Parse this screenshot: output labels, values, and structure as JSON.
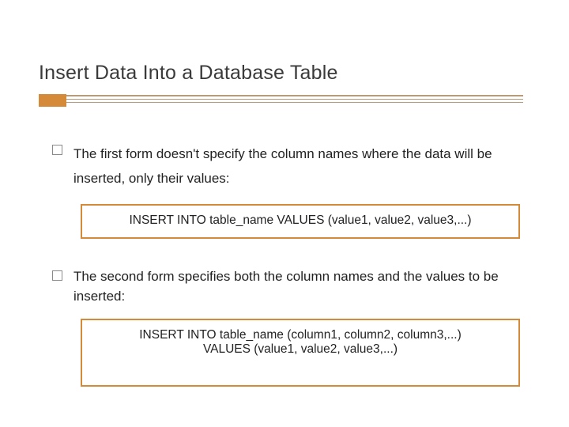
{
  "title": "Insert Data Into a Database Table",
  "bullets": {
    "b1": "The first form doesn't specify the column names where the data will be inserted, only their values:",
    "b2": "The second form specifies both the column names and the values to be inserted:"
  },
  "code": {
    "c1_line1": "INSERT INTO table_name VALUES (value1, value2, value3,...)",
    "c2_line1": "INSERT INTO table_name (column1, column2, column3,...)",
    "c2_line2": "VALUES (value1, value2, value3,...)"
  }
}
